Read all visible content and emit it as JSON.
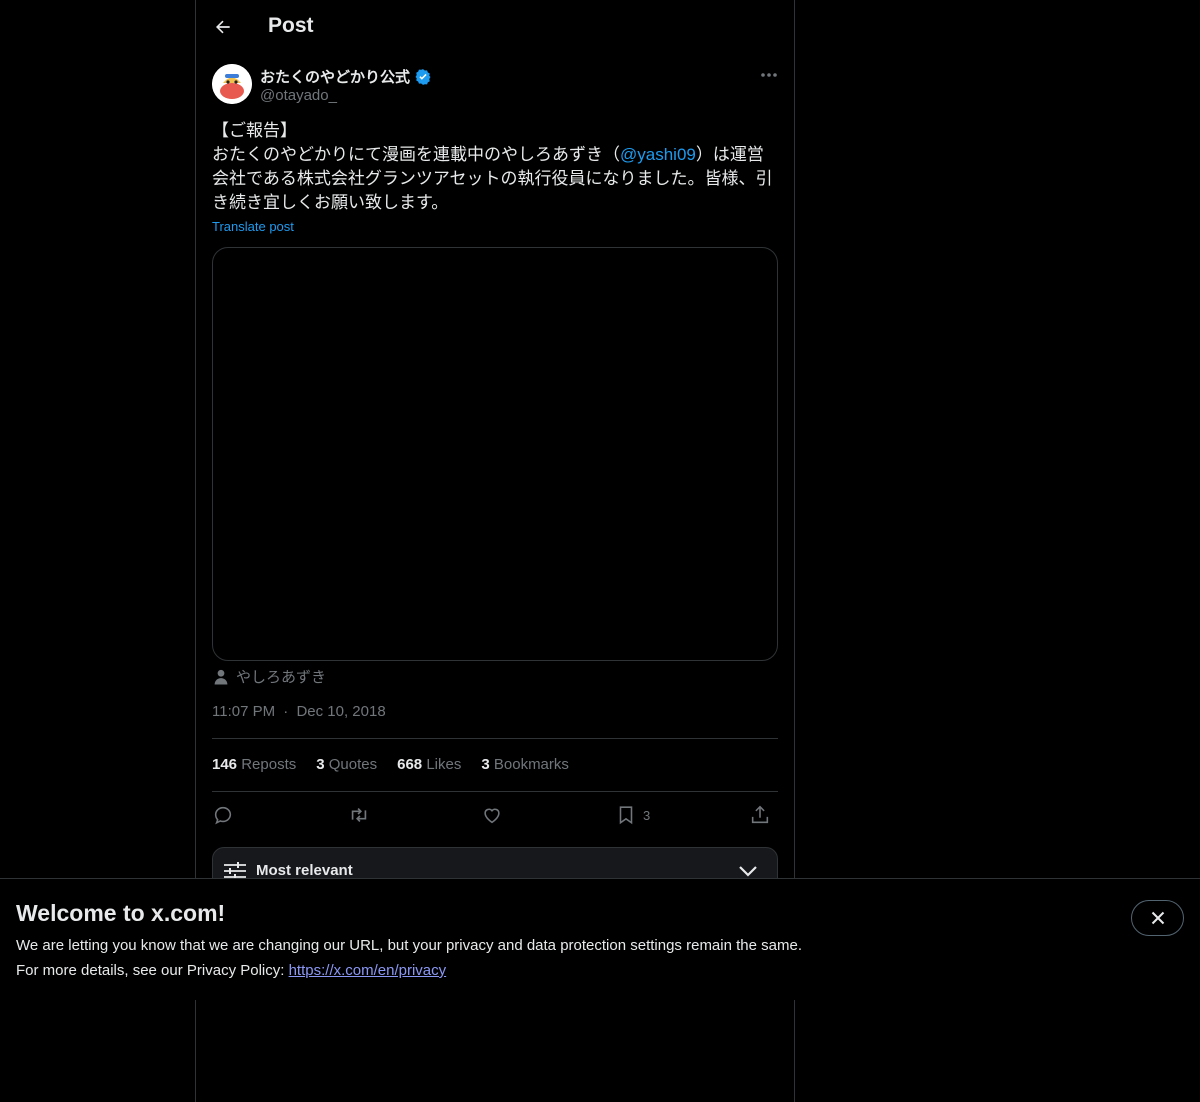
{
  "header": {
    "title": "Post"
  },
  "post": {
    "author": {
      "display_name": "おたくのやどかり公式",
      "handle": "@otayado_",
      "verified": true
    },
    "text_before_mention": "【ご報告】\nおたくのやどかりにて漫画を連載中のやしろあずき（",
    "mention": "@yashi09",
    "text_after_mention": "）は運営会社である株式会社グランツアセットの執行役員になりました。皆様、引き続き宜しくお願い致します。",
    "translate_label": "Translate post",
    "tagged_user": "やしろあずき",
    "time": "11:07 PM",
    "separator": "·",
    "date": "Dec 10, 2018"
  },
  "stats": [
    {
      "count": "146",
      "label": "Reposts"
    },
    {
      "count": "3",
      "label": "Quotes"
    },
    {
      "count": "668",
      "label": "Likes"
    },
    {
      "count": "3",
      "label": "Bookmarks"
    }
  ],
  "actions": {
    "reply_icon": "reply-icon",
    "repost_icon": "repost-icon",
    "like_icon": "heart-icon",
    "bookmark_icon": "bookmark-icon",
    "bookmark_count": "3",
    "share_icon": "share-icon"
  },
  "sort": {
    "label": "Most relevant"
  },
  "banner": {
    "title": "Welcome to x.com!",
    "line1": "We are letting you know that we are changing our URL, but your privacy and data protection settings remain the same.",
    "line2_prefix": "For more details, see our Privacy Policy: ",
    "link_text": "https://x.com/en/privacy"
  },
  "colors": {
    "accent": "#1d9bf0",
    "link_banner": "#8b98f5",
    "muted": "#71767b",
    "border": "#2f3336"
  }
}
